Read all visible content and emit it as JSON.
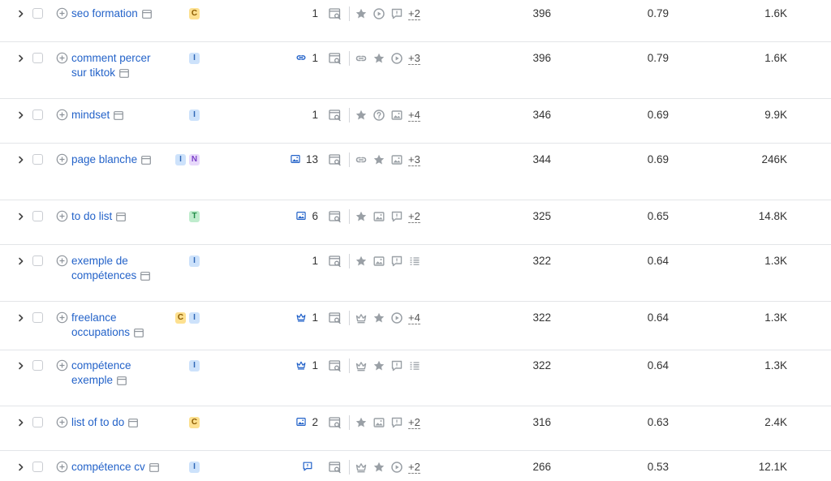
{
  "colors": {
    "link": "#2463c9",
    "icon": "#9aa0a6",
    "accent_icon": "#2463c9",
    "border": "#e3e5e8"
  },
  "rows": [
    {
      "keyword": "seo formation",
      "badges": [
        "C"
      ],
      "rank_feature": "",
      "rank": "1",
      "features": [
        "star-icon",
        "video-icon",
        "review-icon"
      ],
      "more": "+2",
      "volume": "396",
      "kd": "0.79",
      "cpc": "1.6K"
    },
    {
      "keyword": "comment percer sur tiktok",
      "badges": [
        "I"
      ],
      "rank_feature": "link-icon",
      "rank": "1",
      "features": [
        "link-icon",
        "star-icon",
        "video-icon"
      ],
      "more": "+3",
      "volume": "396",
      "kd": "0.79",
      "cpc": "1.6K"
    },
    {
      "keyword": "mindset",
      "badges": [
        "I"
      ],
      "rank_feature": "",
      "rank": "1",
      "features": [
        "star-icon",
        "question-icon",
        "image-icon"
      ],
      "more": "+4",
      "volume": "346",
      "kd": "0.69",
      "cpc": "9.9K"
    },
    {
      "keyword": "page blanche",
      "badges": [
        "I",
        "N"
      ],
      "rank_feature": "image-icon",
      "rank": "13",
      "features": [
        "link-icon",
        "star-icon",
        "image-icon"
      ],
      "more": "+3",
      "volume": "344",
      "kd": "0.69",
      "cpc": "246K"
    },
    {
      "keyword": "to do list",
      "badges": [
        "T"
      ],
      "rank_feature": "image-icon",
      "rank": "6",
      "features": [
        "star-icon",
        "image-icon",
        "review-icon"
      ],
      "more": "+2",
      "volume": "325",
      "kd": "0.65",
      "cpc": "14.8K"
    },
    {
      "keyword": "exemple de compétences",
      "badges": [
        "I"
      ],
      "rank_feature": "",
      "rank": "1",
      "features": [
        "star-icon",
        "image-icon",
        "review-icon",
        "list-icon"
      ],
      "more": "",
      "volume": "322",
      "kd": "0.64",
      "cpc": "1.3K"
    },
    {
      "keyword": "freelance occupations",
      "badges": [
        "C",
        "I"
      ],
      "rank_feature": "crown-icon",
      "rank": "1",
      "features": [
        "crown-icon",
        "star-icon",
        "video-icon"
      ],
      "more": "+4",
      "volume": "322",
      "kd": "0.64",
      "cpc": "1.3K"
    },
    {
      "keyword": "compétence exemple",
      "badges": [
        "I"
      ],
      "rank_feature": "crown-icon",
      "rank": "1",
      "features": [
        "crown-icon",
        "star-icon",
        "review-icon",
        "list-icon"
      ],
      "more": "",
      "volume": "322",
      "kd": "0.64",
      "cpc": "1.3K"
    },
    {
      "keyword": "list of to do",
      "badges": [
        "C"
      ],
      "rank_feature": "image-icon",
      "rank": "2",
      "features": [
        "star-icon",
        "image-icon",
        "review-icon"
      ],
      "more": "+2",
      "volume": "316",
      "kd": "0.63",
      "cpc": "2.4K"
    },
    {
      "keyword": "compétence cv",
      "badges": [
        "I"
      ],
      "rank_feature": "review-icon",
      "rank": "",
      "features": [
        "crown-icon",
        "star-icon",
        "video-icon"
      ],
      "more": "+2",
      "volume": "266",
      "kd": "0.53",
      "cpc": "12.1K"
    }
  ]
}
